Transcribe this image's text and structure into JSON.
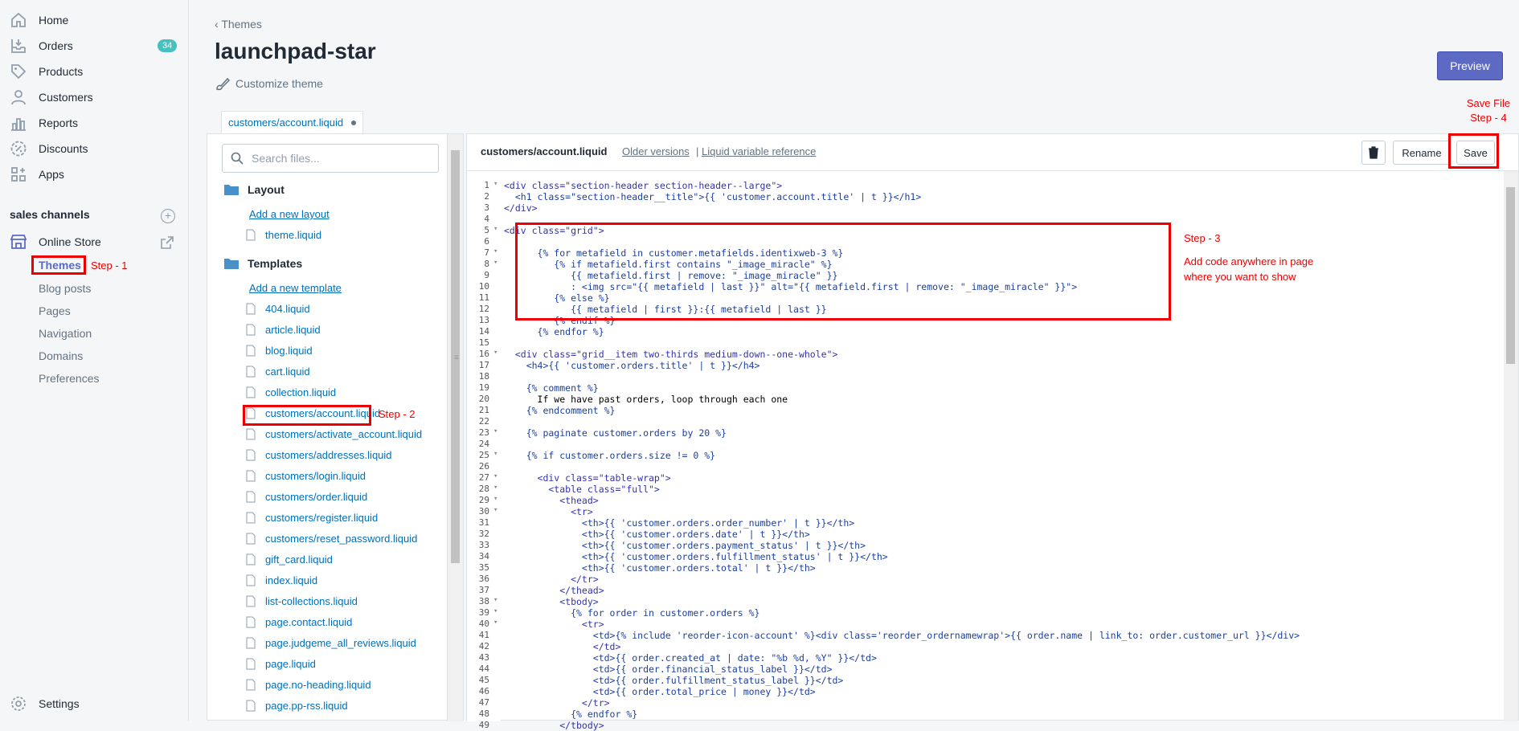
{
  "sidebar": {
    "items": [
      {
        "label": "Home",
        "icon": "home-icon"
      },
      {
        "label": "Orders",
        "icon": "orders-icon",
        "badge": "34"
      },
      {
        "label": "Products",
        "icon": "tag-icon"
      },
      {
        "label": "Customers",
        "icon": "person-icon"
      },
      {
        "label": "Reports",
        "icon": "chart-icon"
      },
      {
        "label": "Discounts",
        "icon": "discount-icon"
      },
      {
        "label": "Apps",
        "icon": "apps-icon"
      }
    ],
    "sales_channels_title": "sales channels",
    "online_store": "Online Store",
    "sub_items": [
      "Themes",
      "Blog posts",
      "Pages",
      "Navigation",
      "Domains",
      "Preferences"
    ],
    "settings": "Settings"
  },
  "annotations": {
    "step1": "Step - 1",
    "step2": "Step - 2",
    "step3": "Step - 3",
    "step3_note1": "Add code anywhere in page",
    "step3_note2": "where you want to show",
    "step4_line1": "Save File",
    "step4_line2": "Step - 4"
  },
  "header": {
    "breadcrumb": "Themes",
    "title": "launchpad-star",
    "customize": "Customize theme",
    "preview": "Preview"
  },
  "tab": {
    "label": "customers/account.liquid"
  },
  "files": {
    "search_placeholder": "Search files...",
    "layout_title": "Layout",
    "add_layout": "Add a new layout",
    "layout_files": [
      "theme.liquid"
    ],
    "templates_title": "Templates",
    "add_template": "Add a new template",
    "template_files": [
      "404.liquid",
      "article.liquid",
      "blog.liquid",
      "cart.liquid",
      "collection.liquid",
      "customers/account.liquid",
      "customers/activate_account.liquid",
      "customers/addresses.liquid",
      "customers/login.liquid",
      "customers/order.liquid",
      "customers/register.liquid",
      "customers/reset_password.liquid",
      "gift_card.liquid",
      "index.liquid",
      "list-collections.liquid",
      "page.contact.liquid",
      "page.judgeme_all_reviews.liquid",
      "page.liquid",
      "page.no-heading.liquid",
      "page.pp-rss.liquid"
    ]
  },
  "editor": {
    "filename": "customers/account.liquid",
    "older_versions": "Older versions",
    "separator": "|",
    "liquid_ref": "Liquid variable reference",
    "rename": "Rename",
    "save": "Save"
  },
  "code_lines": [
    "<div class=\"section-header section-header--large\">",
    "  <h1 class=\"section-header__title\">{{ 'customer.account.title' | t }}</h1>",
    "</div>",
    "",
    "<div class=\"grid\">",
    "",
    "      {% for metafield in customer.metafields.identixweb-3 %}",
    "         {% if metafield.first contains \"_image_miracle\" %}",
    "            {{ metafield.first | remove: \"_image_miracle\" }}",
    "            : <img src=\"{{ metafield | last }}\" alt=\"{{ metafield.first | remove: \"_image_miracle\" }}\">",
    "         {% else %}",
    "            {{ metafield | first }}:{{ metafield | last }}",
    "         {% endif %}",
    "      {% endfor %}",
    "",
    "  <div class=\"grid__item two-thirds medium-down--one-whole\">",
    "    <h4>{{ 'customer.orders.title' | t }}</h4>",
    "",
    "    {% comment %}",
    "      If we have past orders, loop through each one",
    "    {% endcomment %}",
    "",
    "    {% paginate customer.orders by 20 %}",
    "",
    "    {% if customer.orders.size != 0 %}",
    "",
    "      <div class=\"table-wrap\">",
    "        <table class=\"full\">",
    "          <thead>",
    "            <tr>",
    "              <th>{{ 'customer.orders.order_number' | t }}</th>",
    "              <th>{{ 'customer.orders.date' | t }}</th>",
    "              <th>{{ 'customer.orders.payment_status' | t }}</th>",
    "              <th>{{ 'customer.orders.fulfillment_status' | t }}</th>",
    "              <th>{{ 'customer.orders.total' | t }}</th>",
    "            </tr>",
    "          </thead>",
    "          <tbody>",
    "            {% for order in customer.orders %}",
    "              <tr>",
    "                <td>{% include 'reorder-icon-account' %}<div class='reorder_ordernamewrap'>{{ order.name | link_to: order.customer_url }}</div>",
    "                </td>",
    "                <td>{{ order.created_at | date: \"%b %d, %Y\" }}</td>",
    "                <td>{{ order.financial_status_label }}</td>",
    "                <td>{{ order.fulfillment_status_label }}</td>",
    "                <td>{{ order.total_price | money }}</td>",
    "              </tr>",
    "            {% endfor %}",
    "          </tbody>"
  ]
}
